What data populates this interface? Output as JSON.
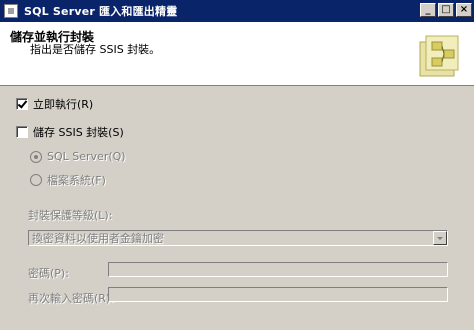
{
  "window": {
    "title": "SQL Server 匯入和匯出精靈"
  },
  "header": {
    "title": "儲存並執行封裝",
    "subtitle": "指出是否儲存 SSIS 封裝。"
  },
  "options": {
    "run_immediately": {
      "label": "立即執行(R)",
      "checked": true
    },
    "save_ssis": {
      "label": "儲存 SSIS 封裝(S)",
      "checked": false
    },
    "sql_server": {
      "label": "SQL Server(Q)",
      "selected": true
    },
    "file_system": {
      "label": "檔案系統(F)",
      "selected": false
    }
  },
  "protection": {
    "label": "封裝保護等級(L):",
    "value": "換密資料以使用者金鑰加密"
  },
  "password": {
    "label": "密碼(P):",
    "value": ""
  },
  "retype_password": {
    "label": "再次輸入密碼(R):",
    "value": ""
  },
  "colors": {
    "titlebar": "#0a246a",
    "face": "#d4d0c8",
    "header_bg": "#ffffff",
    "disabled_text": "#808080"
  },
  "icons": [
    "app-icon",
    "minimize-icon",
    "maximize-icon",
    "close-icon",
    "wizard-graphic-icon",
    "dropdown-arrow-icon"
  ]
}
